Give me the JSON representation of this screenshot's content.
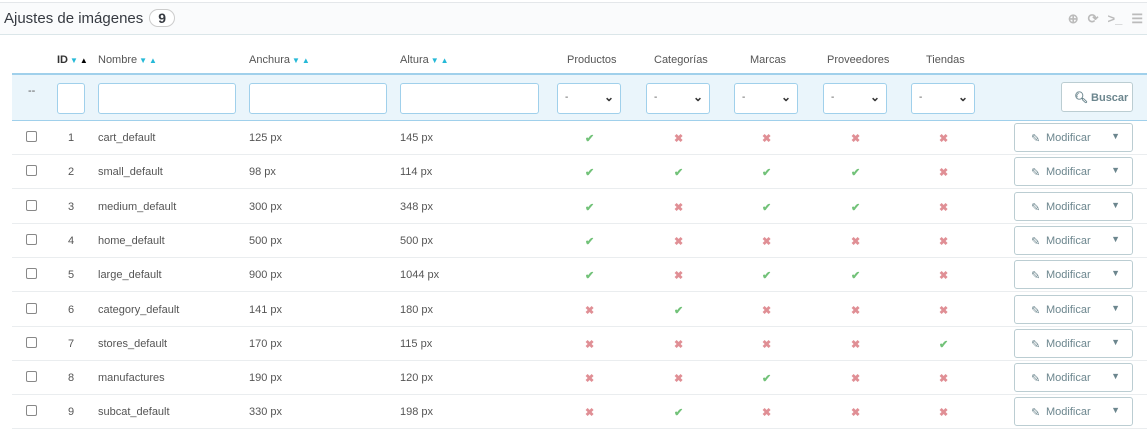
{
  "header": {
    "title": "Ajustes de imágenes",
    "count": "9",
    "icons": [
      "add-icon",
      "refresh-icon",
      "terminal-icon",
      "database-icon"
    ]
  },
  "columns": {
    "id": "ID",
    "name": "Nombre",
    "width": "Anchura",
    "height": "Altura",
    "products": "Productos",
    "categories": "Categorías",
    "brands": "Marcas",
    "suppliers": "Proveedores",
    "stores": "Tiendas"
  },
  "filters": {
    "dash": "--",
    "select_value": "-",
    "search_label": "Buscar"
  },
  "colors": {
    "accent": "#25b9d7",
    "yes": "#72c279",
    "no": "#e08f95"
  },
  "edit_label": "Modificar",
  "rows": [
    {
      "id": "1",
      "name": "cart_default",
      "width": "125 px",
      "height": "145 px",
      "flags": [
        1,
        0,
        0,
        0,
        0
      ]
    },
    {
      "id": "2",
      "name": "small_default",
      "width": "98 px",
      "height": "114 px",
      "flags": [
        1,
        1,
        1,
        1,
        0
      ]
    },
    {
      "id": "3",
      "name": "medium_default",
      "width": "300 px",
      "height": "348 px",
      "flags": [
        1,
        0,
        1,
        1,
        0
      ]
    },
    {
      "id": "4",
      "name": "home_default",
      "width": "500 px",
      "height": "500 px",
      "flags": [
        1,
        0,
        0,
        0,
        0
      ]
    },
    {
      "id": "5",
      "name": "large_default",
      "width": "900 px",
      "height": "1044 px",
      "flags": [
        1,
        0,
        1,
        1,
        0
      ]
    },
    {
      "id": "6",
      "name": "category_default",
      "width": "141 px",
      "height": "180 px",
      "flags": [
        0,
        1,
        0,
        0,
        0
      ]
    },
    {
      "id": "7",
      "name": "stores_default",
      "width": "170 px",
      "height": "115 px",
      "flags": [
        0,
        0,
        0,
        0,
        1
      ]
    },
    {
      "id": "8",
      "name": "manufactures",
      "width": "190 px",
      "height": "120 px",
      "flags": [
        0,
        0,
        1,
        0,
        0
      ]
    },
    {
      "id": "9",
      "name": "subcat_default",
      "width": "330 px",
      "height": "198 px",
      "flags": [
        0,
        1,
        0,
        0,
        0
      ]
    }
  ]
}
